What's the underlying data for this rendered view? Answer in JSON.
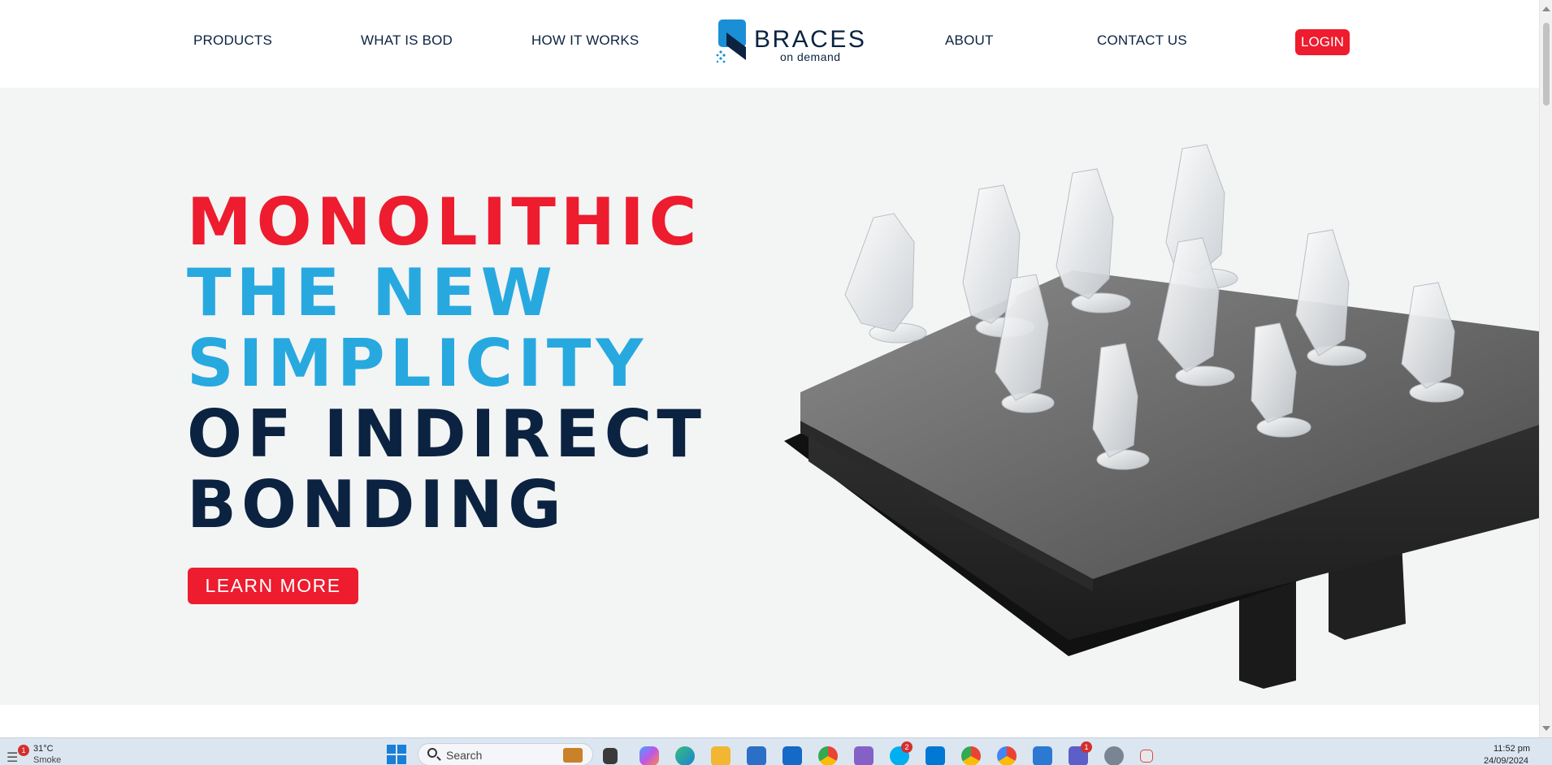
{
  "nav": {
    "left": [
      "PRODUCTS",
      "WHAT IS BOD",
      "HOW IT WORKS"
    ],
    "right": [
      "ABOUT",
      "CONTACT US"
    ],
    "login": "LOGIN"
  },
  "logo": {
    "word": "BRACES",
    "sub": "on demand",
    "colors": {
      "primary": "#0b2341",
      "accent": "#1a8fd6"
    }
  },
  "hero": {
    "lines": [
      "MONOLITHIC",
      "THE NEW",
      "SIMPLICITY",
      "OF INDIRECT",
      "BONDING"
    ],
    "line_colors": [
      "#ed1c2e",
      "#27a9e0",
      "#27a9e0",
      "#0b2341",
      "#0b2341"
    ],
    "cta": "LEARN MORE",
    "image": "3d-printed-bracket-jigs-on-build-plate"
  },
  "colors": {
    "brand_red": "#ed1c2e",
    "brand_blue": "#27a9e0",
    "brand_navy": "#0b2341",
    "hero_bg": "#f3f4f4"
  },
  "taskbar": {
    "weather": {
      "temp": "31°C",
      "condition": "Smoke",
      "badge": "1"
    },
    "search_placeholder": "Search",
    "icons": [
      "briefcase-icon",
      "task-view-icon",
      "copilot-icon",
      "edge-icon",
      "file-explorer-icon",
      "store-icon",
      "outlook-icon",
      "chrome-icon",
      "visual-studio-icon",
      "skype-icon",
      "vscode-icon",
      "chrome-beta-icon",
      "chrome-dev-icon",
      "notepad-icon",
      "teams-icon",
      "settings-icon",
      "snipping-tool-icon"
    ],
    "badges": {
      "skype": "2",
      "teams": "1"
    },
    "time": "11:52 pm",
    "date": "24/09/2024"
  }
}
